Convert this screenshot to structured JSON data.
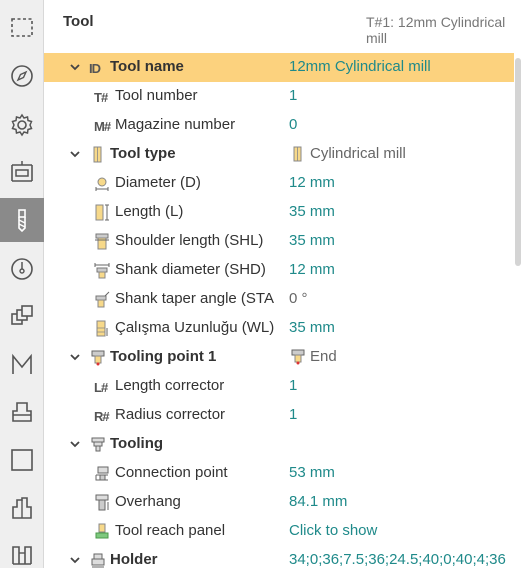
{
  "header": {
    "title": "Tool",
    "selected_tool": "T#1: 12mm Cylindrical mill"
  },
  "sidebar": {
    "items": [
      {
        "icon": "selection-box-icon"
      },
      {
        "icon": "compass-icon"
      },
      {
        "icon": "gear-icon"
      },
      {
        "icon": "machine-icon"
      },
      {
        "icon": "tool-icon",
        "active": true
      },
      {
        "icon": "gauge-icon"
      },
      {
        "icon": "stacked-squares-icon"
      },
      {
        "icon": "m-letter-icon"
      },
      {
        "icon": "workpiece-icon"
      },
      {
        "icon": "square-icon"
      },
      {
        "icon": "fixture-icon"
      },
      {
        "icon": "clamp-icon"
      }
    ]
  },
  "tree": {
    "tool_name": {
      "label": "Tool name",
      "icon_text": "ID",
      "value": "12mm Cylindrical mill"
    },
    "tool_number": {
      "label": "Tool number",
      "icon_text": "T#",
      "value": "1"
    },
    "magazine_number": {
      "label": "Magazine number",
      "icon_text": "M#",
      "value": "0"
    },
    "tool_type": {
      "label": "Tool type",
      "value": "Cylindrical mill"
    },
    "diameter": {
      "label": "Diameter (D)",
      "value": "12 mm"
    },
    "length": {
      "label": "Length (L)",
      "value": "35 mm"
    },
    "shoulder_length": {
      "label": "Shoulder length (SHL)",
      "value": "35 mm"
    },
    "shank_diameter": {
      "label": "Shank diameter (SHD)",
      "value": "12 mm"
    },
    "shank_taper_angle": {
      "label": "Shank taper angle (STA",
      "value": "0 °"
    },
    "working_length": {
      "label": "Çalışma Uzunluğu (WL)",
      "value": "35 mm"
    },
    "tooling_point": {
      "label": "Tooling point 1",
      "value": "End"
    },
    "length_corrector": {
      "label": "Length corrector",
      "icon_text": "L#",
      "value": "1"
    },
    "radius_corrector": {
      "label": "Radius corrector",
      "icon_text": "R#",
      "value": "1"
    },
    "tooling": {
      "label": "Tooling"
    },
    "connection_point": {
      "label": "Connection point",
      "value": "53 mm"
    },
    "overhang": {
      "label": "Overhang",
      "value": "84.1 mm"
    },
    "tool_reach_panel": {
      "label": "Tool reach panel",
      "value": "Click to show"
    },
    "holder": {
      "label": "Holder",
      "value": "34;0;36;7.5;36;24.5;40;0;40;4;36"
    }
  },
  "colors": {
    "selected_row": "#fcd27e",
    "value_text": "#1f8a8a",
    "active_sidebar": "#8a8a8a"
  }
}
